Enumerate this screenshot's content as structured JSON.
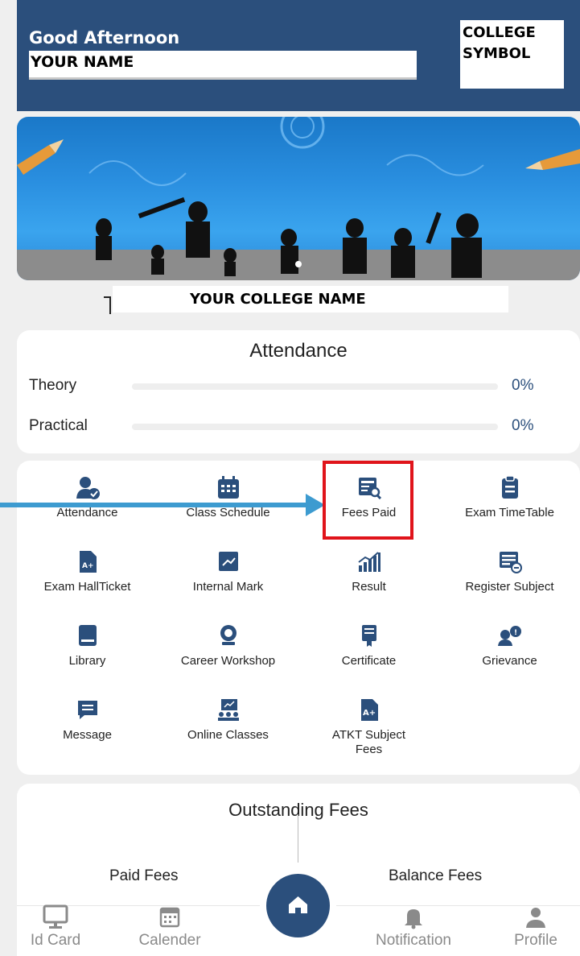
{
  "header": {
    "greeting": "Good Afternoon",
    "user_name": "YOUR NAME",
    "college_symbol": "COLLEGE\nSYMBOL"
  },
  "banner": {
    "college_name": "YOUR COLLEGE NAME"
  },
  "attendance": {
    "title": "Attendance",
    "rows": [
      {
        "label": "Theory",
        "percent_text": "0%",
        "percent": 0
      },
      {
        "label": "Practical",
        "percent_text": "0%",
        "percent": 0
      }
    ]
  },
  "menu": {
    "items": [
      {
        "label": "Attendance",
        "icon": "user-check-icon"
      },
      {
        "label": "Class Schedule",
        "icon": "calendar-grid-icon"
      },
      {
        "label": "Fees Paid",
        "icon": "fees-search-icon"
      },
      {
        "label": "Exam TimeTable",
        "icon": "clipboard-icon"
      },
      {
        "label": "Exam HallTicket",
        "icon": "document-grade-icon"
      },
      {
        "label": "Internal Mark",
        "icon": "chart-card-icon"
      },
      {
        "label": "Result",
        "icon": "bar-chart-icon"
      },
      {
        "label": "Register Subject",
        "icon": "register-list-icon"
      },
      {
        "label": "Library",
        "icon": "book-icon"
      },
      {
        "label": "Career Workshop",
        "icon": "badge-pin-icon"
      },
      {
        "label": "Certificate",
        "icon": "certificate-icon"
      },
      {
        "label": "Grievance",
        "icon": "grievance-icon"
      },
      {
        "label": "Message",
        "icon": "message-icon"
      },
      {
        "label": "Online Classes",
        "icon": "online-class-icon"
      },
      {
        "label": "ATKT Subject\nFees",
        "icon": "document-aplus-icon"
      }
    ]
  },
  "fees": {
    "title": "Outstanding Fees",
    "paid_label": "Paid Fees",
    "balance_label": "Balance Fees"
  },
  "bottom_nav": {
    "items": [
      {
        "label": "Id Card",
        "icon": "id-card-icon"
      },
      {
        "label": "Calender",
        "icon": "calendar-icon"
      },
      {
        "label": "Notification",
        "icon": "bell-icon"
      },
      {
        "label": "Profile",
        "icon": "person-icon"
      }
    ],
    "home_icon": "home-icon"
  },
  "colors": {
    "primary": "#2b4f7c",
    "highlight": "#e0141b",
    "arrow": "#3d9bd0",
    "nav_inactive": "#8a8a8a"
  }
}
